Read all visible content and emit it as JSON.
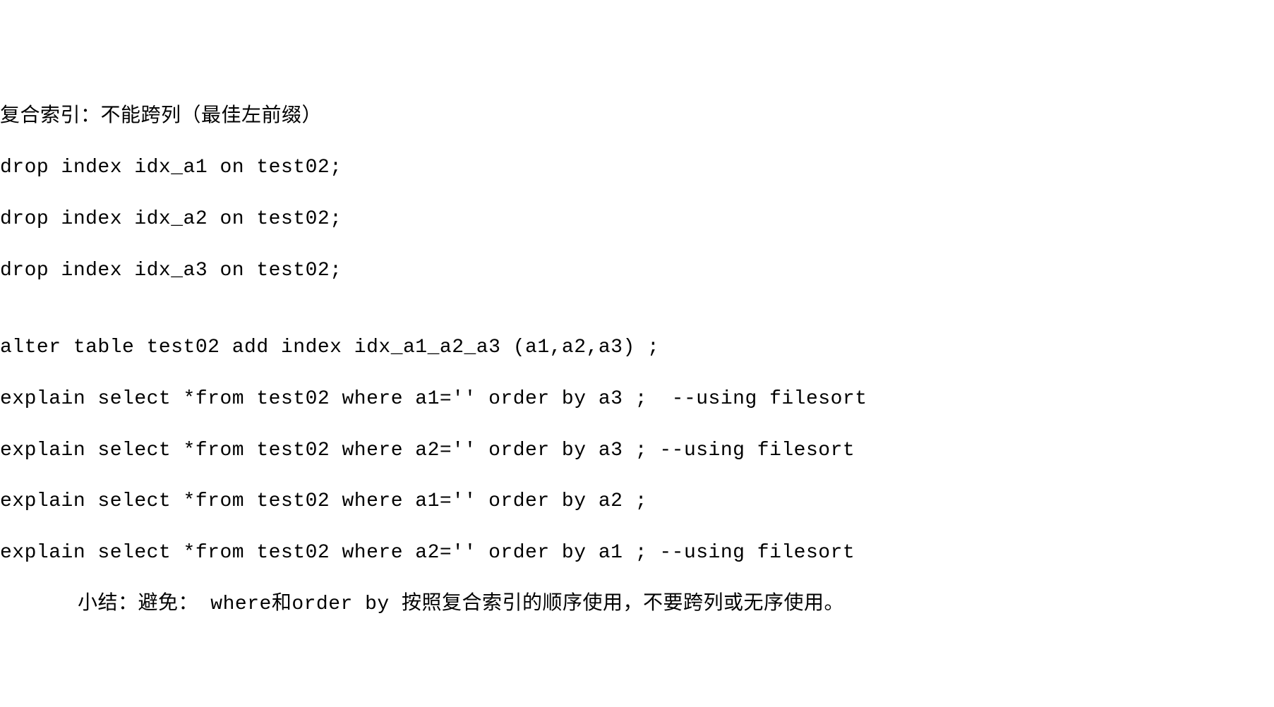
{
  "lines": {
    "l1": "复合索引：不能跨列（最佳左前缀）",
    "l2": "drop index idx_a1 on test02;",
    "l3": "drop index idx_a2 on test02;",
    "l4": "drop index idx_a3 on test02;",
    "l5": "",
    "l6": "alter table test02 add index idx_a1_a2_a3 (a1,a2,a3) ;",
    "l7": "explain select *from test02 where a1='' order by a3 ;  --using filesort",
    "l8": "explain select *from test02 where a2='' order by a3 ; --using filesort",
    "l9": "explain select *from test02 where a1='' order by a2 ;",
    "l10": "explain select *from test02 where a2='' order by a1 ; --using filesort",
    "l11": "小结：避免： where和order by 按照复合索引的顺序使用，不要跨列或无序使用。"
  }
}
